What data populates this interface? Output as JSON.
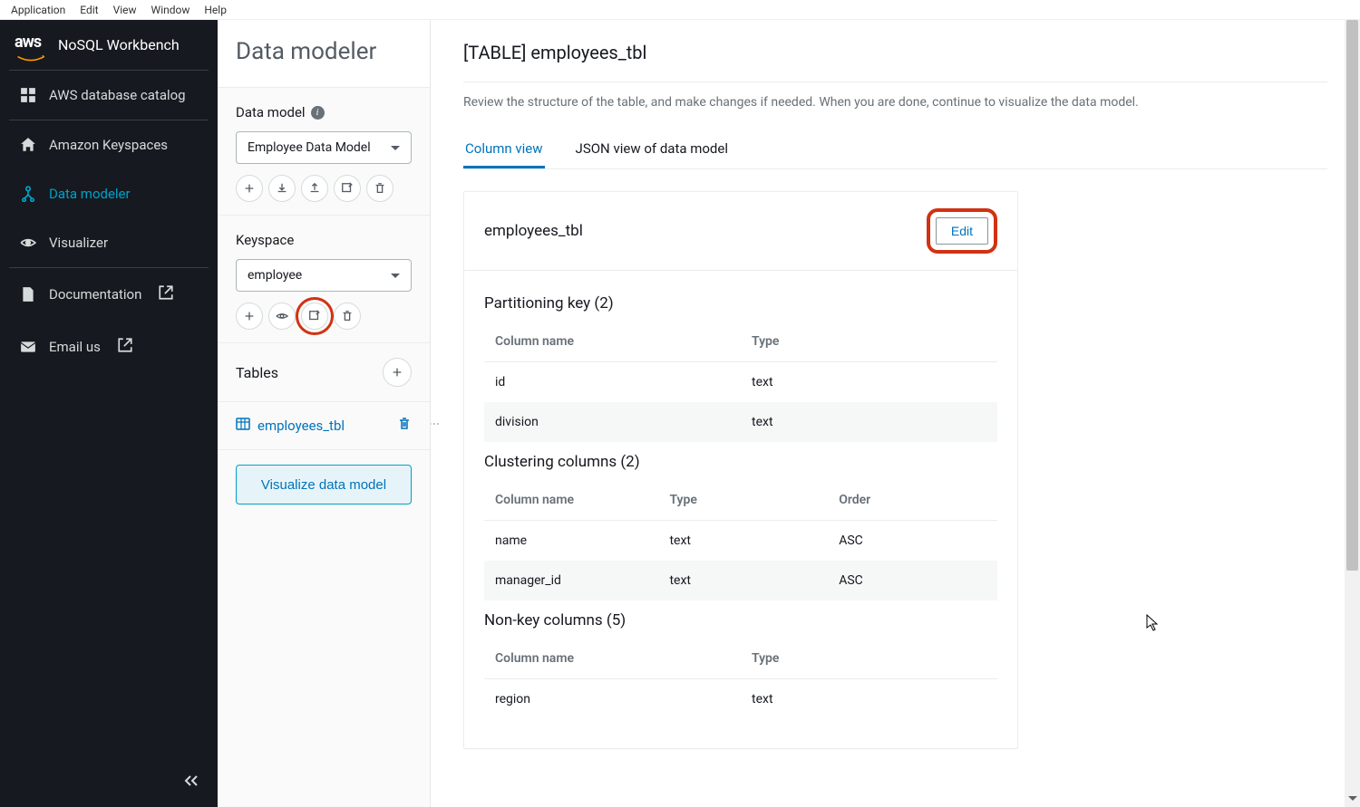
{
  "menubar": [
    "Application",
    "Edit",
    "View",
    "Window",
    "Help"
  ],
  "app": {
    "logo_text": "aws",
    "title": "NoSQL Workbench"
  },
  "sidenav": {
    "items": [
      {
        "label": "AWS database catalog",
        "icon": "grid-icon"
      },
      {
        "label": "Amazon Keyspaces",
        "icon": "home-icon"
      },
      {
        "label": "Data modeler",
        "icon": "modeler-icon",
        "active": true
      },
      {
        "label": "Visualizer",
        "icon": "eye-icon"
      },
      {
        "label": "Documentation",
        "icon": "doc-icon",
        "external": true
      },
      {
        "label": "Email us",
        "icon": "mail-icon",
        "external": true
      }
    ]
  },
  "modeler": {
    "title": "Data modeler",
    "data_model_label": "Data model",
    "data_model_selected": "Employee Data Model",
    "keyspace_label": "Keyspace",
    "keyspace_selected": "employee",
    "tables_label": "Tables",
    "tables": [
      {
        "name": "employees_tbl"
      }
    ],
    "visualize_label": "Visualize data model"
  },
  "main": {
    "page_title": "[TABLE] employees_tbl",
    "subtitle": "Review the structure of the table, and make changes if needed. When you are done, continue to visualize the data model.",
    "tabs": {
      "column": "Column view",
      "json": "JSON view of data model"
    },
    "table_name": "employees_tbl",
    "edit_label": "Edit",
    "partition": {
      "title": "Partitioning key (2)",
      "headers": {
        "col": "Column name",
        "type": "Type"
      },
      "rows": [
        {
          "name": "id",
          "type": "text"
        },
        {
          "name": "division",
          "type": "text"
        }
      ]
    },
    "clustering": {
      "title": "Clustering columns (2)",
      "headers": {
        "col": "Column name",
        "type": "Type",
        "order": "Order"
      },
      "rows": [
        {
          "name": "name",
          "type": "text",
          "order": "ASC"
        },
        {
          "name": "manager_id",
          "type": "text",
          "order": "ASC"
        }
      ]
    },
    "nonkey": {
      "title": "Non-key columns (5)",
      "headers": {
        "col": "Column name",
        "type": "Type"
      },
      "rows": [
        {
          "name": "region",
          "type": "text"
        }
      ]
    }
  }
}
